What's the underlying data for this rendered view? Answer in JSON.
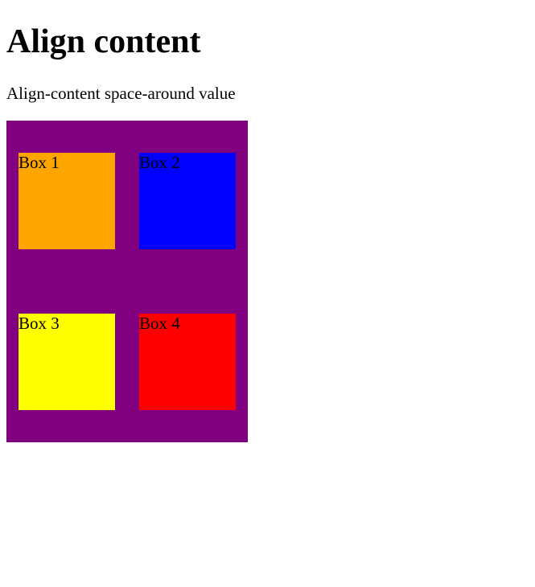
{
  "heading": "Align content",
  "description": "Align-content space-around value",
  "container": {
    "backgroundColor": "purple"
  },
  "boxes": [
    {
      "label": "Box 1",
      "color": "orange"
    },
    {
      "label": "Box 2",
      "color": "blue"
    },
    {
      "label": "Box 3",
      "color": "yellow"
    },
    {
      "label": "Box 4",
      "color": "red"
    }
  ]
}
